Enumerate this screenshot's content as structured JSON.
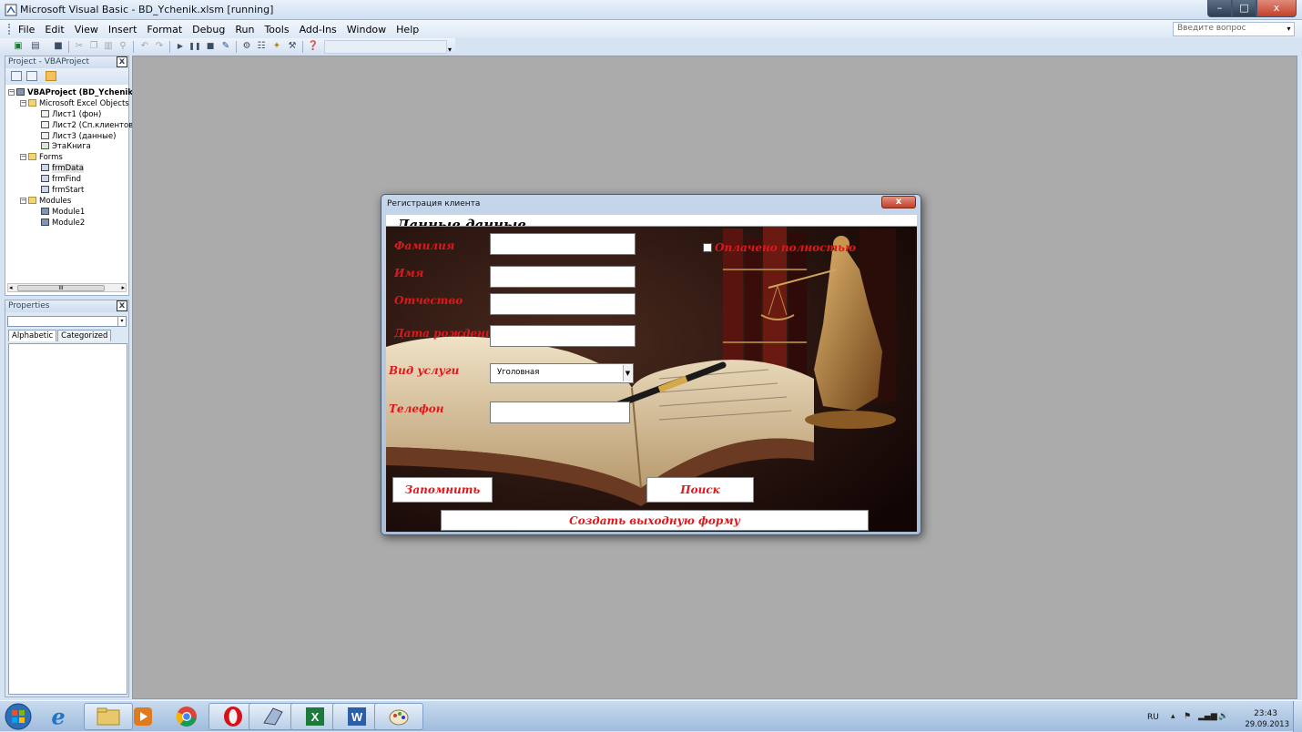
{
  "window": {
    "title": "Microsoft Visual Basic - BD_Ychenik.xlsm [running]",
    "controls": {
      "minimize": "–",
      "maximize": "□",
      "close": "x"
    }
  },
  "menu": {
    "items": [
      {
        "label": "File"
      },
      {
        "label": "Edit"
      },
      {
        "label": "View"
      },
      {
        "label": "Insert"
      },
      {
        "label": "Format"
      },
      {
        "label": "Debug"
      },
      {
        "label": "Run"
      },
      {
        "label": "Tools"
      },
      {
        "label": "Add-Ins"
      },
      {
        "label": "Window"
      },
      {
        "label": "Help"
      }
    ],
    "help_placeholder": "Введите вопрос",
    "help_dropdown": "▾"
  },
  "toolbar": {
    "icons": [
      "excel-icon",
      "insert-userform-icon",
      "save-icon",
      "cut-icon",
      "copy-icon",
      "paste-icon",
      "find-icon",
      "undo-icon",
      "redo-icon",
      "run-icon",
      "break-icon",
      "reset-icon",
      "design-mode-icon",
      "project-explorer-icon",
      "properties-icon",
      "object-browser-icon",
      "toolbox-icon",
      "help-icon"
    ],
    "overflow": "▾"
  },
  "project_panel": {
    "title": "Project - VBAProject",
    "close": "x",
    "tree": [
      {
        "label": "VBAProject (BD_Ychenik",
        "level": 0,
        "expander": "−",
        "icon": "vbaproject-icon",
        "bold": true
      },
      {
        "label": "Microsoft Excel Objects",
        "level": 1,
        "expander": "−",
        "icon": "folder-icon"
      },
      {
        "label": "Лист1 (фон)",
        "level": 2,
        "icon": "worksheet-icon"
      },
      {
        "label": "Лист2 (Сп.клиентов",
        "level": 2,
        "icon": "worksheet-icon"
      },
      {
        "label": "Лист3 (данные)",
        "level": 2,
        "icon": "worksheet-icon"
      },
      {
        "label": "ЭтаКнига",
        "level": 2,
        "icon": "workbook-icon"
      },
      {
        "label": "Forms",
        "level": 1,
        "expander": "−",
        "icon": "folder-icon"
      },
      {
        "label": "frmData",
        "level": 2,
        "icon": "userform-icon",
        "selected": true
      },
      {
        "label": "frmFind",
        "level": 2,
        "icon": "userform-icon"
      },
      {
        "label": "frmStart",
        "level": 2,
        "icon": "userform-icon"
      },
      {
        "label": "Modules",
        "level": 1,
        "expander": "−",
        "icon": "folder-icon"
      },
      {
        "label": "Module1",
        "level": 2,
        "icon": "module-icon"
      },
      {
        "label": "Module2",
        "level": 2,
        "icon": "module-icon"
      }
    ],
    "scroll_thumb": "III"
  },
  "properties_panel": {
    "title": "Properties",
    "close": "x",
    "object_selector": "",
    "dropdown": "▾",
    "tabs": [
      {
        "label": "Alphabetic",
        "active": true
      },
      {
        "label": "Categorized",
        "active": false
      }
    ]
  },
  "form": {
    "title": "Регистрация клиента",
    "close": "x",
    "frame_caption": "Данные данные",
    "fields": {
      "surname_label": "Фамилия",
      "name_label": "Имя",
      "patronymic_label": "Отчество",
      "birthdate_label": "Дата рождения",
      "service_label": "Вид услуги",
      "phone_label": "Телефон"
    },
    "values": {
      "surname": "",
      "name": "",
      "patronymic": "",
      "birthdate": "",
      "phone": ""
    },
    "service_selected": "Уголовная",
    "paid_checkbox_label": "Оплачено полностью",
    "paid_checked": false,
    "buttons": {
      "remember": "Запомнить",
      "search": "Поиск",
      "create_output": "Создать выходную форму"
    },
    "accent_color": "#e0171b"
  },
  "taskbar": {
    "apps": [
      "windows-start-icon",
      "internet-explorer-icon",
      "file-explorer-icon",
      "media-player-icon",
      "chrome-icon",
      "opera-icon",
      "vba-editor-icon",
      "excel-icon",
      "word-icon",
      "paint-icon"
    ],
    "language": "RU",
    "time": "23:43",
    "date": "29.09.2013"
  },
  "colors": {
    "workspace": "#ababab",
    "chrome": "#d6e3f3"
  }
}
